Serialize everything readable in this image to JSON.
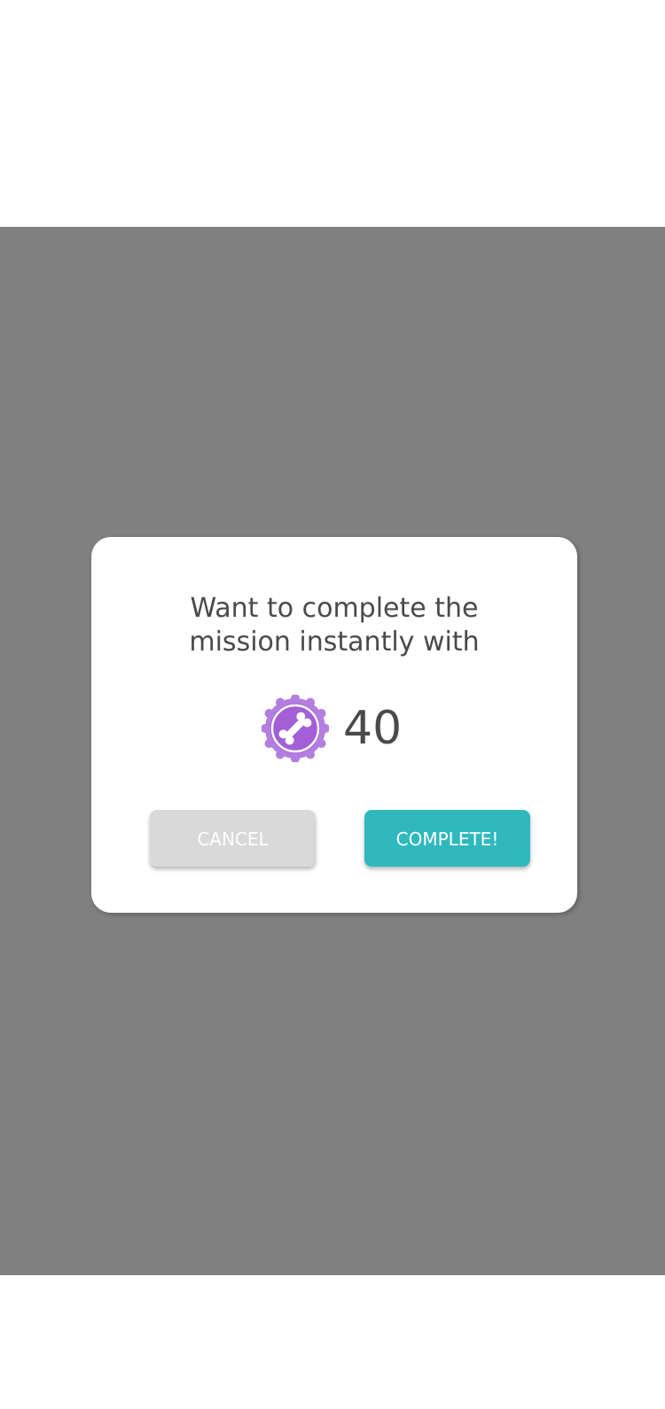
{
  "dialog": {
    "message_line1": "Want to complete the",
    "message_line2": "mission instantly with",
    "cost": "40",
    "currency_icon": "bone-badge-icon",
    "cancel_label": "CANCEL",
    "complete_label": "COMPLETE!"
  },
  "colors": {
    "overlay": "#808080",
    "complete_button": "#2fb9bd",
    "cancel_button": "#d9d9d9",
    "badge": "#a25fd6",
    "text": "#4a4a4a"
  }
}
